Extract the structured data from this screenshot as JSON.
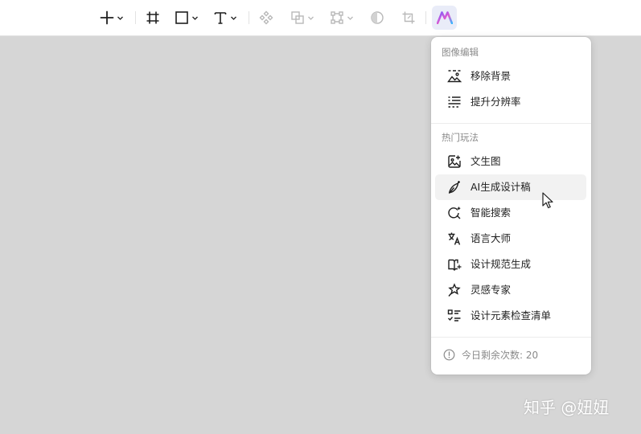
{
  "toolbar": {
    "tools": [
      {
        "icon": "plus-icon",
        "has_dropdown": true
      },
      {
        "icon": "frame-icon",
        "has_dropdown": false
      },
      {
        "icon": "rectangle-icon",
        "has_dropdown": true
      },
      {
        "icon": "text-icon",
        "has_dropdown": true
      },
      {
        "icon": "component-icon",
        "has_dropdown": false
      },
      {
        "icon": "boolean-icon",
        "has_dropdown": true
      },
      {
        "icon": "vector-path-icon",
        "has_dropdown": true
      },
      {
        "icon": "mask-icon",
        "has_dropdown": false
      },
      {
        "icon": "crop-icon",
        "has_dropdown": false
      },
      {
        "icon": "ai-logo-icon",
        "active": true
      }
    ]
  },
  "menu": {
    "section_image_edit": {
      "title": "图像编辑",
      "items": [
        {
          "label": "移除背景",
          "icon": "remove-background-icon"
        },
        {
          "label": "提升分辨率",
          "icon": "upscale-icon"
        }
      ]
    },
    "section_popular": {
      "title": "热门玩法",
      "items": [
        {
          "label": "文生图",
          "icon": "text-to-image-icon"
        },
        {
          "label": "AI生成设计稿",
          "icon": "ai-pen-icon"
        },
        {
          "label": "智能搜索",
          "icon": "smart-search-icon"
        },
        {
          "label": "语言大师",
          "icon": "translate-icon"
        },
        {
          "label": "设计规范生成",
          "icon": "design-spec-icon"
        },
        {
          "label": "灵感专家",
          "icon": "inspiration-icon"
        },
        {
          "label": "设计元素检查清单",
          "icon": "checklist-icon"
        }
      ]
    },
    "footer": {
      "text": "今日剩余次数: 20",
      "icon": "info-circle-icon"
    }
  },
  "watermark": {
    "text": "知乎 @妞妞"
  },
  "colors": {
    "canvas": "#d6d6d6",
    "menu_bg": "#ffffff",
    "hover_bg": "#f2f2f2",
    "ai_button_bg": "#e9ecf8",
    "ai_gradient_start": "#7b5cff",
    "ai_gradient_end": "#36b6ff"
  }
}
